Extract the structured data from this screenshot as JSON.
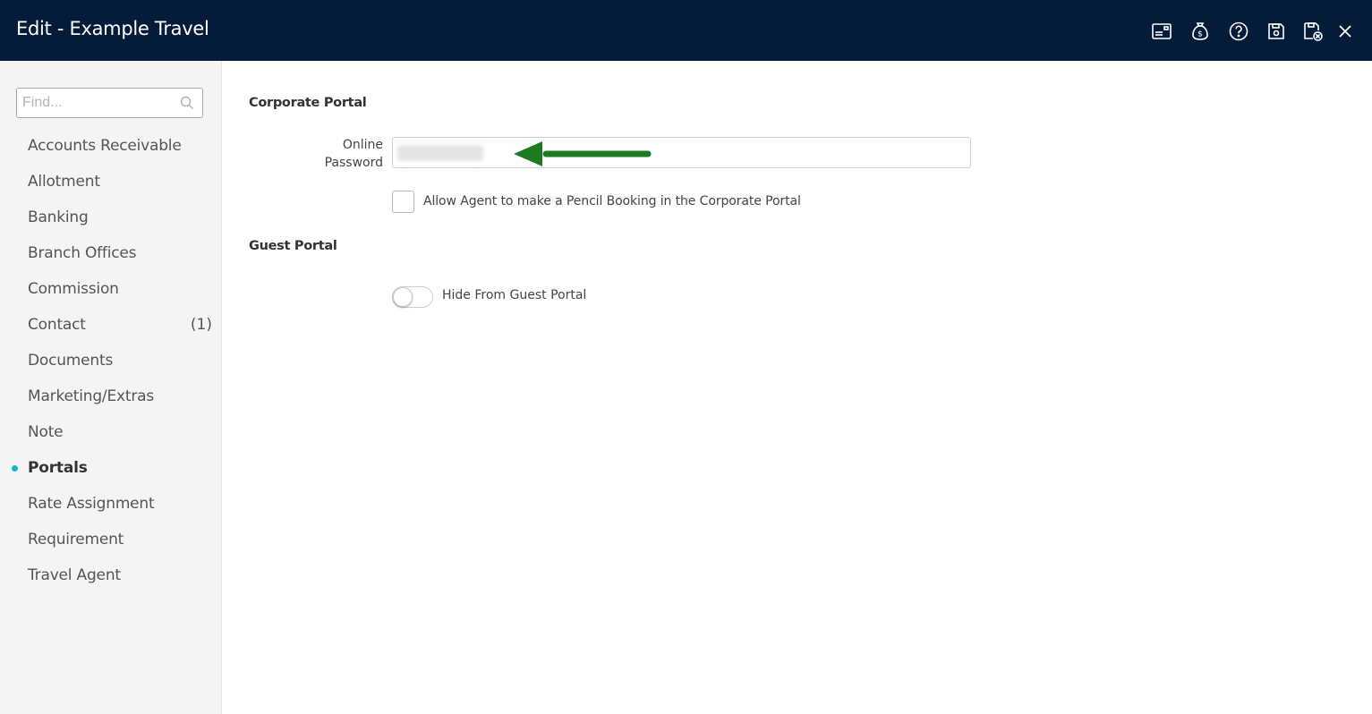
{
  "window": {
    "title": "Edit - Example Travel",
    "toolbar_icons": [
      "card-icon",
      "money-bag-icon",
      "help-icon",
      "save-icon",
      "save-close-icon",
      "close-icon"
    ]
  },
  "sidebar": {
    "search": {
      "placeholder": "Find...",
      "value": ""
    },
    "items": [
      {
        "label": "Accounts Receivable",
        "count": ""
      },
      {
        "label": "Allotment",
        "count": ""
      },
      {
        "label": "Banking",
        "count": ""
      },
      {
        "label": "Branch Offices",
        "count": ""
      },
      {
        "label": "Commission",
        "count": ""
      },
      {
        "label": "Contact",
        "count": "(1)"
      },
      {
        "label": "Documents",
        "count": ""
      },
      {
        "label": "Marketing/Extras",
        "count": ""
      },
      {
        "label": "Note",
        "count": ""
      },
      {
        "label": "Portals",
        "count": "",
        "active": true
      },
      {
        "label": "Rate Assignment",
        "count": ""
      },
      {
        "label": "Requirement",
        "count": ""
      },
      {
        "label": "Travel Agent",
        "count": ""
      }
    ]
  },
  "main": {
    "corporate_portal": {
      "heading": "Corporate Portal",
      "password_label_line1": "Online",
      "password_label_line2": "Password",
      "pencil_booking_label": "Allow Agent to make a Pencil Booking in the Corporate Portal",
      "pencil_booking_checked": false
    },
    "guest_portal": {
      "heading": "Guest Portal",
      "hide_label": "Hide From Guest Portal",
      "hide_enabled": false
    }
  },
  "colors": {
    "titlebar": "#041c3a",
    "active_dot": "#10b5d3",
    "annotation_arrow": "#1e7a23"
  }
}
